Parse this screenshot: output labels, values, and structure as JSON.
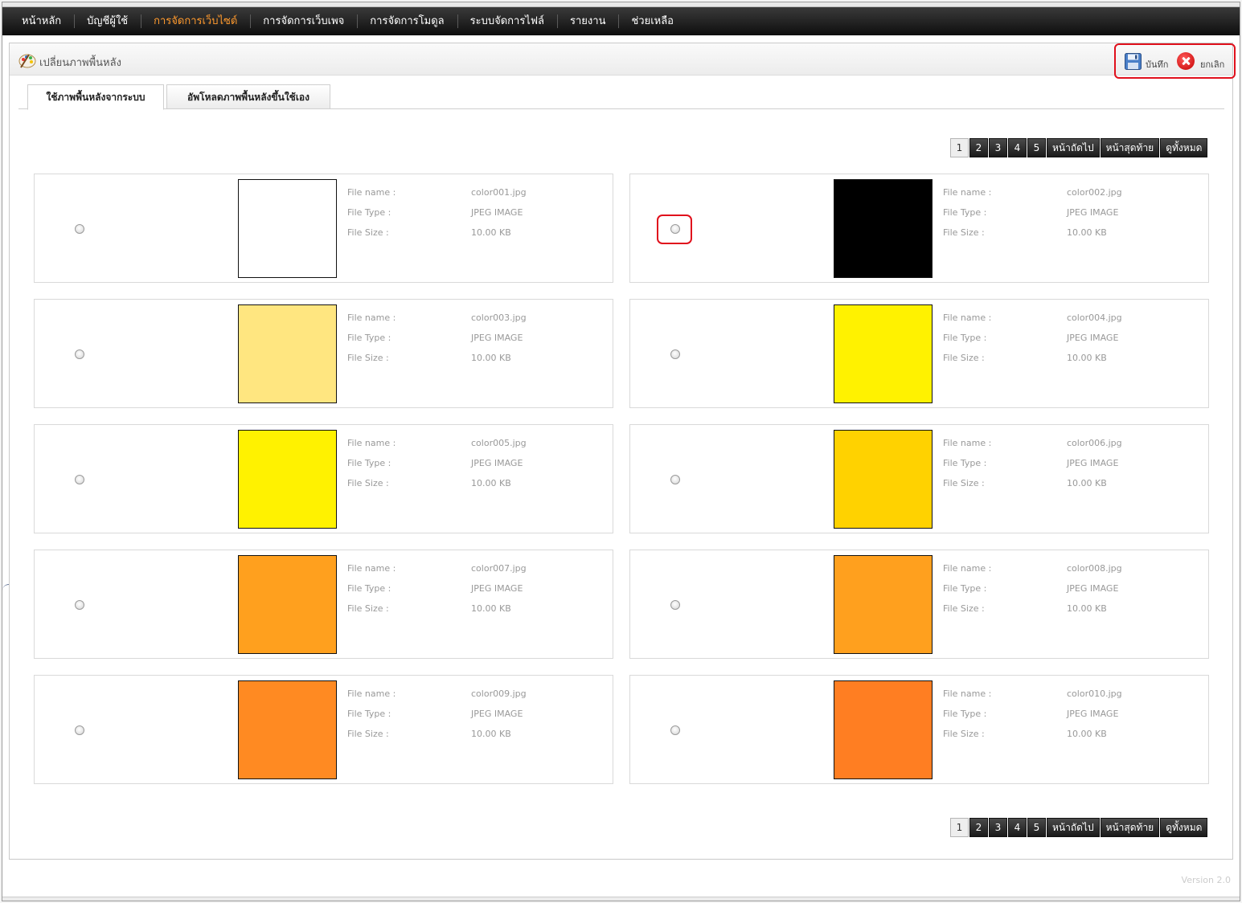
{
  "nav": {
    "items": [
      {
        "label": "หน้าหลัก"
      },
      {
        "label": "บัญชีผู้ใช้"
      },
      {
        "label": "การจัดการเว็บไซต์"
      },
      {
        "label": "การจัดการเว็บเพจ"
      },
      {
        "label": "การจัดการโมดูล"
      },
      {
        "label": "ระบบจัดการไฟล์"
      },
      {
        "label": "รายงาน"
      },
      {
        "label": "ช่วยเหลือ"
      }
    ],
    "active_index": 2,
    "active_color": "#ff9a2e"
  },
  "panel": {
    "title": "เปลี่ยนภาพพื้นหลัง",
    "save_label": "บันทึก",
    "cancel_label": "ยกเลิก"
  },
  "tabs": [
    {
      "label": "ใช้ภาพพื้นหลังจากระบบ",
      "active": true
    },
    {
      "label": "อัพโหลดภาพพื้นหลังขึ้นใช้เอง",
      "active": false
    }
  ],
  "pagination": {
    "pages": [
      "1",
      "2",
      "3",
      "4",
      "5"
    ],
    "current": "1",
    "next_label": "หน้าถัดไป",
    "last_label": "หน้าสุดท้าย",
    "all_label": "ดูทั้งหมด"
  },
  "field_labels": {
    "file_name": "File name :",
    "file_type": "File Type :",
    "file_size": "File Size :"
  },
  "items": [
    {
      "file_name": "color001.jpg",
      "file_type": "JPEG IMAGE",
      "file_size": "10.00 KB",
      "color": "#ffffff"
    },
    {
      "file_name": "color002.jpg",
      "file_type": "JPEG IMAGE",
      "file_size": "10.00 KB",
      "color": "#000000"
    },
    {
      "file_name": "color003.jpg",
      "file_type": "JPEG IMAGE",
      "file_size": "10.00 KB",
      "color": "#ffe680"
    },
    {
      "file_name": "color004.jpg",
      "file_type": "JPEG IMAGE",
      "file_size": "10.00 KB",
      "color": "#fff200"
    },
    {
      "file_name": "color005.jpg",
      "file_type": "JPEG IMAGE",
      "file_size": "10.00 KB",
      "color": "#fff200"
    },
    {
      "file_name": "color006.jpg",
      "file_type": "JPEG IMAGE",
      "file_size": "10.00 KB",
      "color": "#ffd200"
    },
    {
      "file_name": "color007.jpg",
      "file_type": "JPEG IMAGE",
      "file_size": "10.00 KB",
      "color": "#ffa01e"
    },
    {
      "file_name": "color008.jpg",
      "file_type": "JPEG IMAGE",
      "file_size": "10.00 KB",
      "color": "#ffa01e"
    },
    {
      "file_name": "color009.jpg",
      "file_type": "JPEG IMAGE",
      "file_size": "10.00 KB",
      "color": "#ff8a22"
    },
    {
      "file_name": "color010.jpg",
      "file_type": "JPEG IMAGE",
      "file_size": "10.00 KB",
      "color": "#ff7e22"
    }
  ],
  "highlighted_item_index": 1,
  "footer": {
    "version": "Version 2.0"
  }
}
